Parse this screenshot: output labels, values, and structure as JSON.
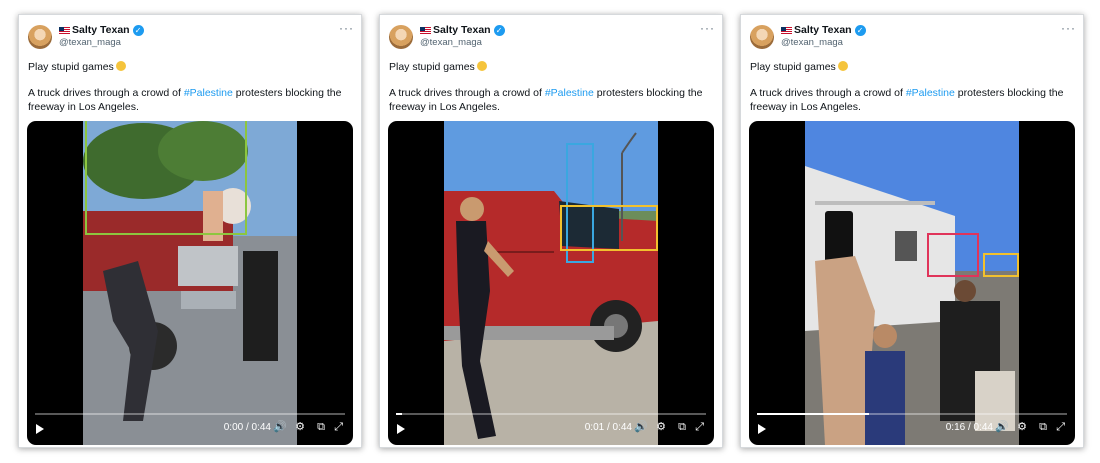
{
  "colors": {
    "hashtag": "#1d9bf0",
    "verified": "#1d9bf0",
    "box_green": "#8dc63f",
    "box_blue": "#3aa7e0",
    "box_yellow": "#f2c12e",
    "box_red": "#e0345a"
  },
  "posts": [
    {
      "display_name": "Salty Texan",
      "handle": "@texan_maga",
      "line1": "Play stupid games",
      "text_before": "A truck drives through a crowd of ",
      "hashtag": "#Palestine",
      "text_after": " protesters blocking the freeway in Los Angeles.",
      "time": "0:00 / 0:44",
      "progress": 0.0
    },
    {
      "display_name": "Salty Texan",
      "handle": "@texan_maga",
      "line1": "Play stupid games",
      "text_before": "A truck drives through a crowd of ",
      "hashtag": "#Palestine",
      "text_after": " protesters blocking the freeway in Los Angeles.",
      "time": "0:01 / 0:44",
      "progress": 0.02
    },
    {
      "display_name": "Salty Texan",
      "handle": "@texan_maga",
      "line1": "Play stupid games",
      "text_before": "A truck drives through a crowd of ",
      "hashtag": "#Palestine",
      "text_after": " protesters blocking the freeway in Los Angeles.",
      "time": "0:16 / 0:44",
      "progress": 0.36
    }
  ]
}
